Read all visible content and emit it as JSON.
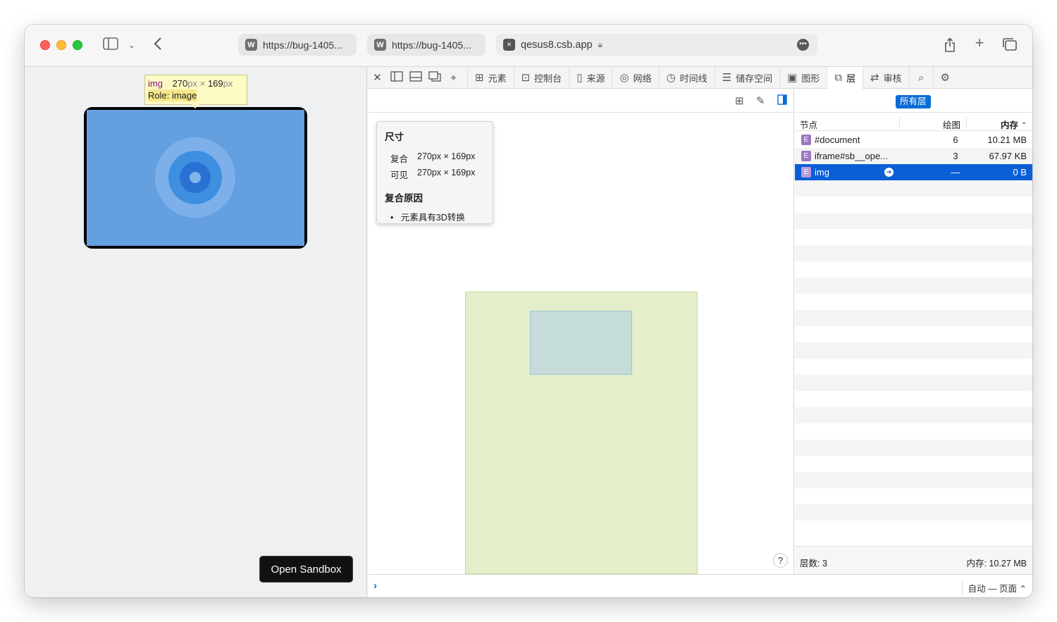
{
  "browser": {
    "tabs": [
      {
        "favicon": "W",
        "title": "https://bug-1405..."
      },
      {
        "favicon": "W",
        "title": "https://bug-1405..."
      },
      {
        "favicon": "✕",
        "title": "qesus8.csb.app"
      }
    ]
  },
  "page": {
    "tooltip": {
      "tag": "img",
      "width": "270",
      "height": "169",
      "unit": "px",
      "times": "×",
      "role": "Role: image"
    },
    "open_sandbox_label": "Open Sandbox"
  },
  "devtools": {
    "tabs": [
      {
        "icon": "elements-icon",
        "label": "元素"
      },
      {
        "icon": "console-icon",
        "label": "控制台"
      },
      {
        "icon": "sources-icon",
        "label": "来源"
      },
      {
        "icon": "network-icon",
        "label": "网络"
      },
      {
        "icon": "timeline-icon",
        "label": "时间线"
      },
      {
        "icon": "storage-icon",
        "label": "储存空间"
      },
      {
        "icon": "graphics-icon",
        "label": "图形"
      },
      {
        "icon": "layers-icon",
        "label": "层"
      },
      {
        "icon": "audit-icon",
        "label": "审核"
      }
    ],
    "active_tab": "层",
    "dimensions_popup": {
      "heading": "尺寸",
      "rows": [
        {
          "key": "复合",
          "value": "270px × 169px"
        },
        {
          "key": "可见",
          "value": "270px × 169px"
        }
      ],
      "reasons_heading": "复合原因",
      "reasons": [
        "元素具有3D转换"
      ]
    },
    "help_label": "?",
    "console_mode": "自动 — 页面 ⌃"
  },
  "layers_sidebar": {
    "filter_label": "所有层",
    "columns": {
      "node": "节点",
      "paints": "绘图",
      "memory": "内存"
    },
    "rows": [
      {
        "node": "#document",
        "paints": "6",
        "memory": "10.21 MB",
        "selected": false
      },
      {
        "node": "iframe#sb__ope...",
        "paints": "3",
        "memory": "67.97 KB",
        "selected": false
      },
      {
        "node": "img",
        "paints": "—",
        "memory": "0 B",
        "selected": true
      }
    ],
    "footer": {
      "layer_count": "层数:  3",
      "memory_total": "内存:  10.27 MB"
    }
  }
}
